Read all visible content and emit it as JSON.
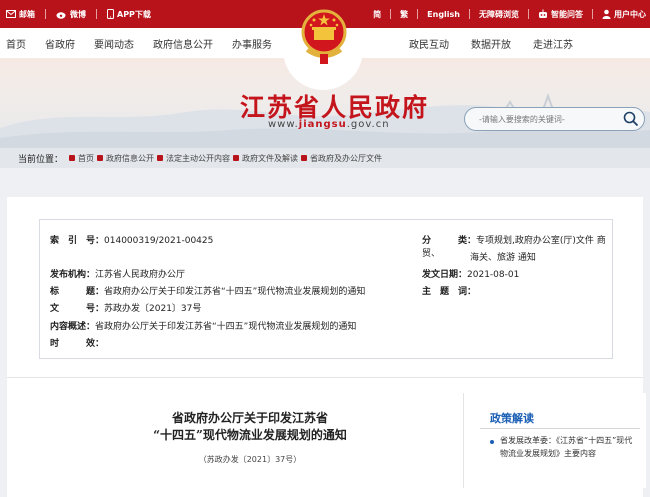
{
  "topbar": {
    "left": [
      {
        "icon": "mail-icon",
        "label": "邮箱"
      },
      {
        "icon": "weibo-icon",
        "label": "微博"
      },
      {
        "icon": "phone-icon",
        "label": "APP下载"
      }
    ],
    "right": [
      {
        "icon": "",
        "label": "简"
      },
      {
        "icon": "",
        "label": "繁"
      },
      {
        "icon": "",
        "label": "English"
      },
      {
        "icon": "",
        "label": "无障碍浏览"
      },
      {
        "icon": "robot-icon",
        "label": "智能问答"
      },
      {
        "icon": "user-icon",
        "label": "用户中心"
      }
    ]
  },
  "nav": {
    "left": [
      "首页",
      "省政府",
      "要闻动态",
      "政府信息公开",
      "办事服务"
    ],
    "right": [
      "政民互动",
      "数据开放",
      "走进江苏"
    ]
  },
  "banner": {
    "title": "江苏省人民政府",
    "url_prefix": "www.",
    "url_brand": "jiangsu",
    "url_suffix": ".gov.cn",
    "search_placeholder": "-请输入要搜索的关键词-"
  },
  "breadcrumb": {
    "label": "当前位置：",
    "items": [
      "首页",
      "政府信息公开",
      "法定主动公开内容",
      "政府文件及解读",
      "省政府及办公厅文件"
    ]
  },
  "meta": {
    "index_k": "索　引　号：",
    "index_v": "014000319/2021-00425",
    "cat_k": "分　　　类：",
    "cat_v1": "专项规划,政府办公室(厅)文件 商贸、",
    "cat_v2": "海关、旅游 通知",
    "org_k": "发布机构：",
    "org_v": "江苏省人民政府办公厅",
    "date_k": "发文日期：",
    "date_v": "2021-08-01",
    "title_k": "标　　　题：",
    "title_v": "省政府办公厅关于印发江苏省“十四五”现代物流业发展规划的通知",
    "topic_k": "主　题　词：",
    "topic_v": "",
    "num_k": "文　　　号：",
    "num_v": "苏政办发〔2021〕37号",
    "summary_k": "内容概述：",
    "summary_v": "省政府办公厅关于印发江苏省“十四五”现代物流业发展规划的通知",
    "eff_k": "时　　　效："
  },
  "document": {
    "title_line1": "省政府办公厅关于印发江苏省",
    "title_line2": "“十四五”现代物流业发展规划的通知",
    "doc_no": "（苏政办发〔2021〕37号）"
  },
  "sidebar": {
    "heading": "政策解读",
    "items": [
      "省发展改革委：《江苏省“十四五”现代物流业发展规划》主要内容"
    ]
  },
  "colors": {
    "brand_red": "#b8121b",
    "link_blue": "#1a5fb4"
  }
}
